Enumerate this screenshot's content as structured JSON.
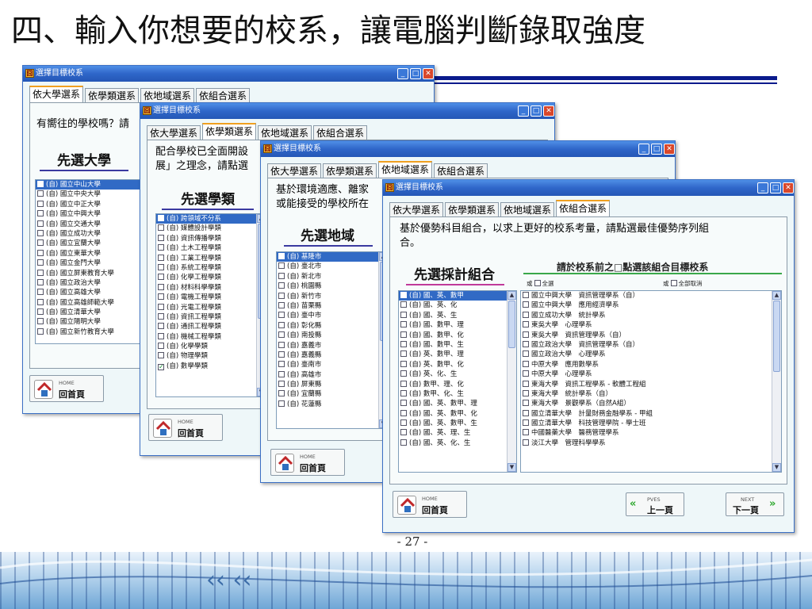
{
  "slide": {
    "title": "四、輸入你想要的校系，讓電腦判斷錄取強度",
    "page_number": "- 27 -"
  },
  "common": {
    "window_title": "選擇目標校系",
    "app_icon": "囧",
    "minimize": "_",
    "maximize": "□",
    "close": "✕",
    "tabs": [
      "依大學選系",
      "依學類選系",
      "依地域選系",
      "依組合選系"
    ],
    "home_small": "HOME",
    "home_label": "回首頁"
  },
  "win1": {
    "active_tab": 0,
    "prompt": "有嚮往的學校嗎？請",
    "section_title": "先選大學",
    "items": [
      "(自) 國立中山大學",
      "(自) 國立中央大學",
      "(自) 國立中正大學",
      "(自) 國立中興大學",
      "(自) 國立交通大學",
      "(自) 國立成功大學",
      "(自) 國立宜蘭大學",
      "(自) 國立東華大學",
      "(自) 國立金門大學",
      "(自) 國立屏東教育大學",
      "(自) 國立政治大學",
      "(自) 國立高雄大學",
      "(自) 國立高雄師範大學",
      "(自) 國立清華大學",
      "(自) 國立陽明大學",
      "(自) 國立新竹教育大學"
    ],
    "selected_index": 0
  },
  "win2": {
    "active_tab": 1,
    "prompt_line1": "配合學校已全面開設",
    "prompt_line2": "展」之理念，請點選",
    "section_title": "先選學類",
    "items": [
      "(自) 跨領域不分系",
      "(自) 媒體設計學類",
      "(自) 資訊傳播學類",
      "(自) 土木工程學類",
      "(自) 工業工程學類",
      "(自) 系統工程學類",
      "(自) 化學工程學類",
      "(自) 材料科學學類",
      "(自) 電機工程學類",
      "(自) 光電工程學類",
      "(自) 資訊工程學類",
      "(自) 通訊工程學類",
      "(自) 機械工程學類",
      "(自) 化學學類",
      "(自) 物理學類",
      "(自) 數學學類"
    ],
    "selected_index": 0,
    "checked_index": 15
  },
  "win3": {
    "active_tab": 2,
    "prompt_line1": "基於環境適應、離家",
    "prompt_line2": "或能接受的學校所在",
    "section_title": "先選地域",
    "items": [
      "(自) 基隆市",
      "(自) 臺北市",
      "(自) 新北市",
      "(自) 桃園縣",
      "(自) 新竹市",
      "(自) 苗栗縣",
      "(自) 臺中市",
      "(自) 彰化縣",
      "(自) 南投縣",
      "(自) 嘉義市",
      "(自) 嘉義縣",
      "(自) 臺南市",
      "(自) 高雄市",
      "(自) 屏東縣",
      "(自) 宜蘭縣",
      "(自) 花蓮縣"
    ],
    "selected_index": 0
  },
  "win4": {
    "active_tab": 3,
    "prompt_line1": "基於優勢科目組合，以求上更好的校系考量，請點選最佳優勢序列組",
    "prompt_line2": "合。",
    "section_title": "先選採計組合",
    "hint": "請於校系前之□點選該組合目標校系",
    "select_all_prefix": "或",
    "select_all": "全選",
    "deselect_all_prefix": "或",
    "deselect_all": "全部取消",
    "combos": [
      "(自) 國、英、數甲",
      "(自) 國、英、化",
      "(自) 國、英、生",
      "(自) 國、數甲、理",
      "(自) 國、數甲、化",
      "(自) 國、數甲、生",
      "(自) 英、數甲、理",
      "(自) 英、數甲、化",
      "(自) 英、化、生",
      "(自) 數甲、理、化",
      "(自) 數甲、化、生",
      "(自) 國、英、數甲、理",
      "(自) 國、英、數甲、化",
      "(自) 國、英、數甲、生",
      "(自) 國、英、理、生",
      "(自) 國、英、化、生"
    ],
    "combo_selected_index": 0,
    "schools": [
      "國立中興大學　資訊管理學系（自）",
      "國立中興大學　應用經濟學系",
      "國立成功大學　統計學系",
      "東吳大學　心理學系",
      "東吳大學　資訊管理學系（自）",
      "國立政治大學　資訊管理學系（自）",
      "國立政治大學　心理學系",
      "中原大學　應用數學系",
      "中原大學　心理學系",
      "東海大學　資訊工程學系 - 軟體工程組",
      "東海大學　統計學系（自）",
      "東海大學　景觀學系（自然A組）",
      "國立清華大學　計量財務金融學系 - 甲組",
      "國立清華大學　科技管理學院 - 學士班",
      "中國醫藥大學　醫務管理學系",
      "淡江大學　管理科學學系"
    ],
    "prev_small": "PVES",
    "prev_label": "上一頁",
    "next_small": "NEXT",
    "next_label": "下一頁"
  }
}
